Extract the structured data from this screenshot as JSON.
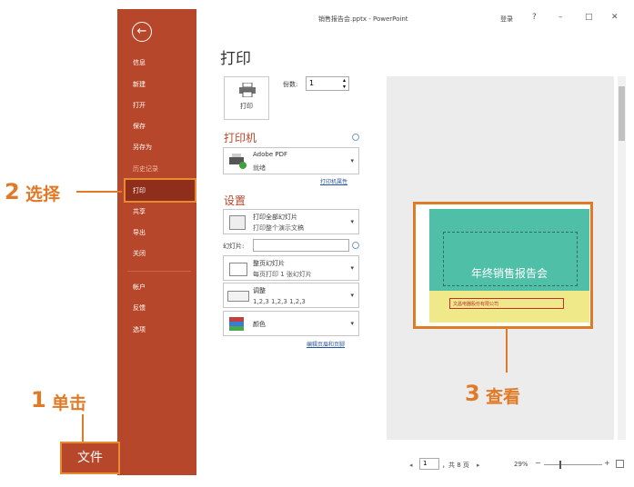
{
  "window": {
    "doc_title": "销售报告会.pptx  -  PowerPoint",
    "login": "登录",
    "help": "?",
    "minimize": "–",
    "maximize": "□",
    "close": "✕"
  },
  "backstage": {
    "back_icon": "←",
    "items": [
      "信息",
      "新建",
      "打开",
      "保存",
      "另存为",
      "历史记录",
      "打印",
      "共享",
      "导出",
      "关闭",
      "帐户",
      "反馈",
      "选项"
    ]
  },
  "annotations": {
    "select_num": "2",
    "select_text": "选择",
    "click_num": "1",
    "click_text": "单击",
    "file_label": "文件",
    "view_num": "3",
    "view_text": "查看"
  },
  "print": {
    "heading": "打印",
    "button_label": "打印",
    "copies_label": "份数:",
    "copies_value": "1",
    "printer_section": "打印机",
    "printer_name": "Adobe PDF",
    "printer_status": "就绪",
    "printer_props": "打印机属性",
    "settings_section": "设置",
    "range_l1": "打印全部幻灯片",
    "range_l2": "打印整个演示文稿",
    "slides_label": "幻灯片:",
    "layout_l1": "整页幻灯片",
    "layout_l2": "每页打印 1 张幻灯片",
    "collate_l1": "调整",
    "collate_l2": "1,2,3    1,2,3    1,2,3",
    "color_l1": "颜色",
    "edit_header_footer": "编辑页眉和页脚"
  },
  "preview": {
    "slide_title": "年终销售报告会",
    "company": "文昌电器股份有限公司",
    "page_current": "1",
    "page_total": "，共 8 页",
    "zoom": "29%"
  }
}
